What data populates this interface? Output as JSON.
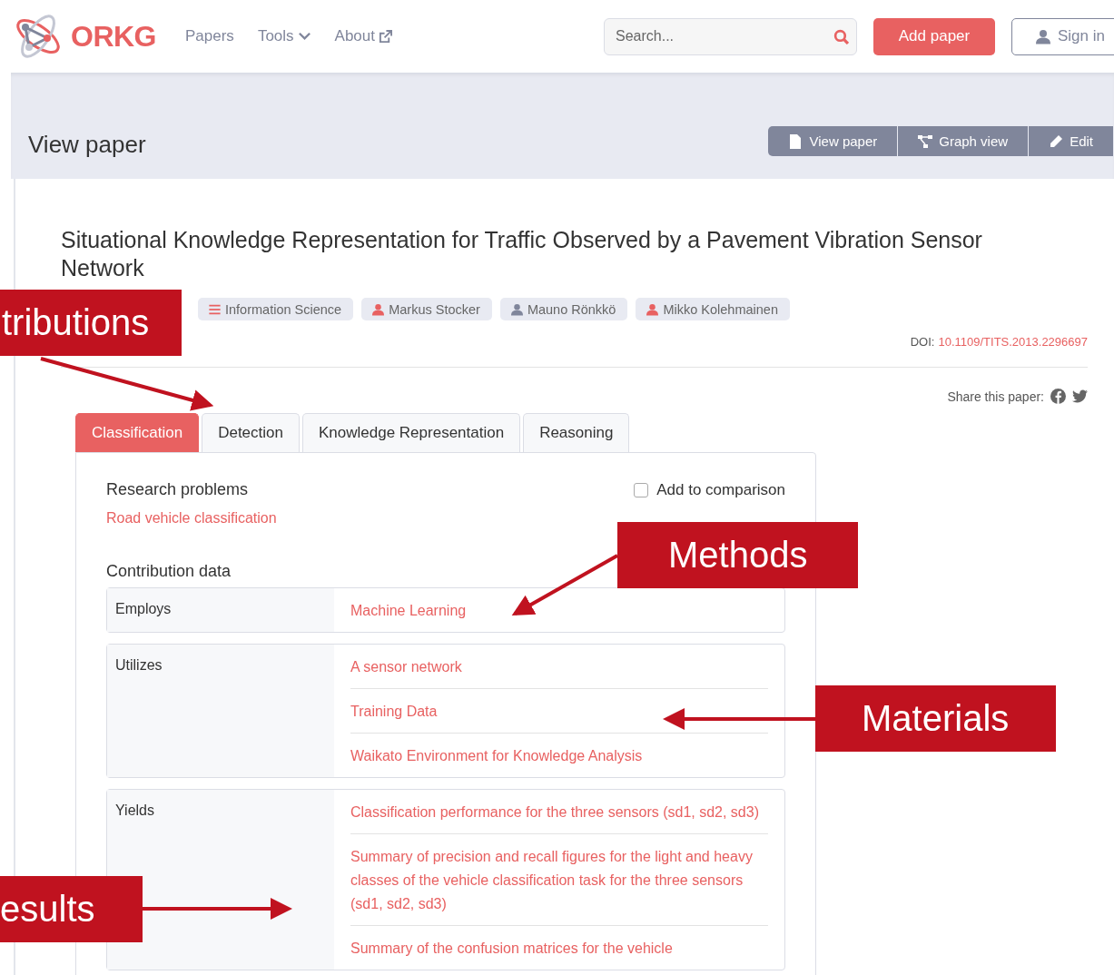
{
  "header": {
    "logo_text": "ORKG",
    "nav": [
      {
        "label": "Papers",
        "kind": "link"
      },
      {
        "label": "Tools",
        "kind": "dropdown"
      },
      {
        "label": "About",
        "kind": "external"
      }
    ],
    "search": {
      "placeholder": "Search..."
    },
    "add_button": "Add paper",
    "sign_in": "Sign in"
  },
  "page_title": "View paper",
  "view_buttons": [
    {
      "label": "View paper",
      "kind": "file"
    },
    {
      "label": "Graph view",
      "kind": "graph"
    },
    {
      "label": "Edit",
      "kind": "edit"
    }
  ],
  "paper": {
    "title": "Situational Knowledge Representation for Traffic Observed by a Pavement Vibration Sensor Network",
    "chips": [
      {
        "kind": "field",
        "label": "Information Science"
      },
      {
        "kind": "author",
        "label": "Markus Stocker",
        "linked": true
      },
      {
        "kind": "author",
        "label": "Mauno Rönkkö",
        "linked": false
      },
      {
        "kind": "author",
        "label": "Mikko Kolehmainen",
        "linked": true
      }
    ],
    "doi_label": "DOI:",
    "doi": "10.1109/TITS.2013.2296697",
    "share_label": "Share this paper:"
  },
  "tabs": [
    {
      "label": "Classification",
      "selected": true
    },
    {
      "label": "Detection",
      "selected": false
    },
    {
      "label": "Knowledge Representation",
      "selected": false
    },
    {
      "label": "Reasoning",
      "selected": false
    }
  ],
  "contribution": {
    "research_problems_heading": "Research problems",
    "research_problem": "Road vehicle classification",
    "add_to_comparison": {
      "label": "Add to comparison",
      "checked": false
    },
    "data_heading": "Contribution data",
    "properties": [
      {
        "label": "Employs",
        "values": [
          "Machine Learning"
        ]
      },
      {
        "label": "Utilizes",
        "values": [
          "A sensor network",
          "Training Data",
          "Waikato Environment for Knowledge Analysis"
        ]
      },
      {
        "label": "Yields",
        "values": [
          "Classification performance for the three sensors (sd1, sd2, sd3)",
          "Summary of precision and recall figures for the light and heavy classes of the vehicle classification task for the three sensors (sd1, sd2, sd3)",
          "Summary of the confusion matrices for the vehicle"
        ]
      }
    ]
  },
  "annotations": [
    {
      "text": "tributions"
    },
    {
      "text": "Methods"
    },
    {
      "text": "Materials"
    },
    {
      "text": "esults"
    }
  ]
}
